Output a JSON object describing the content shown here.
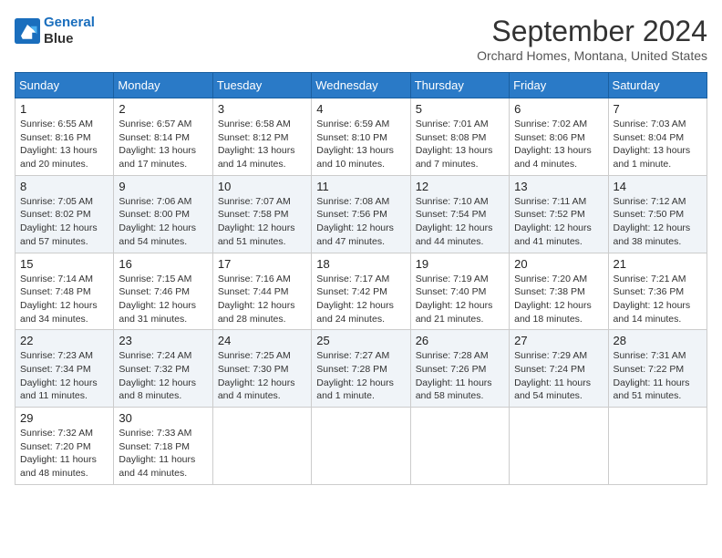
{
  "header": {
    "logo_line1": "General",
    "logo_line2": "Blue",
    "month_title": "September 2024",
    "subtitle": "Orchard Homes, Montana, United States"
  },
  "days_of_week": [
    "Sunday",
    "Monday",
    "Tuesday",
    "Wednesday",
    "Thursday",
    "Friday",
    "Saturday"
  ],
  "weeks": [
    [
      {
        "day": "1",
        "info": "Sunrise: 6:55 AM\nSunset: 8:16 PM\nDaylight: 13 hours\nand 20 minutes."
      },
      {
        "day": "2",
        "info": "Sunrise: 6:57 AM\nSunset: 8:14 PM\nDaylight: 13 hours\nand 17 minutes."
      },
      {
        "day": "3",
        "info": "Sunrise: 6:58 AM\nSunset: 8:12 PM\nDaylight: 13 hours\nand 14 minutes."
      },
      {
        "day": "4",
        "info": "Sunrise: 6:59 AM\nSunset: 8:10 PM\nDaylight: 13 hours\nand 10 minutes."
      },
      {
        "day": "5",
        "info": "Sunrise: 7:01 AM\nSunset: 8:08 PM\nDaylight: 13 hours\nand 7 minutes."
      },
      {
        "day": "6",
        "info": "Sunrise: 7:02 AM\nSunset: 8:06 PM\nDaylight: 13 hours\nand 4 minutes."
      },
      {
        "day": "7",
        "info": "Sunrise: 7:03 AM\nSunset: 8:04 PM\nDaylight: 13 hours\nand 1 minute."
      }
    ],
    [
      {
        "day": "8",
        "info": "Sunrise: 7:05 AM\nSunset: 8:02 PM\nDaylight: 12 hours\nand 57 minutes."
      },
      {
        "day": "9",
        "info": "Sunrise: 7:06 AM\nSunset: 8:00 PM\nDaylight: 12 hours\nand 54 minutes."
      },
      {
        "day": "10",
        "info": "Sunrise: 7:07 AM\nSunset: 7:58 PM\nDaylight: 12 hours\nand 51 minutes."
      },
      {
        "day": "11",
        "info": "Sunrise: 7:08 AM\nSunset: 7:56 PM\nDaylight: 12 hours\nand 47 minutes."
      },
      {
        "day": "12",
        "info": "Sunrise: 7:10 AM\nSunset: 7:54 PM\nDaylight: 12 hours\nand 44 minutes."
      },
      {
        "day": "13",
        "info": "Sunrise: 7:11 AM\nSunset: 7:52 PM\nDaylight: 12 hours\nand 41 minutes."
      },
      {
        "day": "14",
        "info": "Sunrise: 7:12 AM\nSunset: 7:50 PM\nDaylight: 12 hours\nand 38 minutes."
      }
    ],
    [
      {
        "day": "15",
        "info": "Sunrise: 7:14 AM\nSunset: 7:48 PM\nDaylight: 12 hours\nand 34 minutes."
      },
      {
        "day": "16",
        "info": "Sunrise: 7:15 AM\nSunset: 7:46 PM\nDaylight: 12 hours\nand 31 minutes."
      },
      {
        "day": "17",
        "info": "Sunrise: 7:16 AM\nSunset: 7:44 PM\nDaylight: 12 hours\nand 28 minutes."
      },
      {
        "day": "18",
        "info": "Sunrise: 7:17 AM\nSunset: 7:42 PM\nDaylight: 12 hours\nand 24 minutes."
      },
      {
        "day": "19",
        "info": "Sunrise: 7:19 AM\nSunset: 7:40 PM\nDaylight: 12 hours\nand 21 minutes."
      },
      {
        "day": "20",
        "info": "Sunrise: 7:20 AM\nSunset: 7:38 PM\nDaylight: 12 hours\nand 18 minutes."
      },
      {
        "day": "21",
        "info": "Sunrise: 7:21 AM\nSunset: 7:36 PM\nDaylight: 12 hours\nand 14 minutes."
      }
    ],
    [
      {
        "day": "22",
        "info": "Sunrise: 7:23 AM\nSunset: 7:34 PM\nDaylight: 12 hours\nand 11 minutes."
      },
      {
        "day": "23",
        "info": "Sunrise: 7:24 AM\nSunset: 7:32 PM\nDaylight: 12 hours\nand 8 minutes."
      },
      {
        "day": "24",
        "info": "Sunrise: 7:25 AM\nSunset: 7:30 PM\nDaylight: 12 hours\nand 4 minutes."
      },
      {
        "day": "25",
        "info": "Sunrise: 7:27 AM\nSunset: 7:28 PM\nDaylight: 12 hours\nand 1 minute."
      },
      {
        "day": "26",
        "info": "Sunrise: 7:28 AM\nSunset: 7:26 PM\nDaylight: 11 hours\nand 58 minutes."
      },
      {
        "day": "27",
        "info": "Sunrise: 7:29 AM\nSunset: 7:24 PM\nDaylight: 11 hours\nand 54 minutes."
      },
      {
        "day": "28",
        "info": "Sunrise: 7:31 AM\nSunset: 7:22 PM\nDaylight: 11 hours\nand 51 minutes."
      }
    ],
    [
      {
        "day": "29",
        "info": "Sunrise: 7:32 AM\nSunset: 7:20 PM\nDaylight: 11 hours\nand 48 minutes."
      },
      {
        "day": "30",
        "info": "Sunrise: 7:33 AM\nSunset: 7:18 PM\nDaylight: 11 hours\nand 44 minutes."
      },
      null,
      null,
      null,
      null,
      null
    ]
  ]
}
